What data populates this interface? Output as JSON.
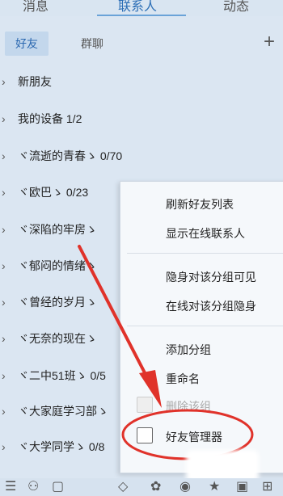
{
  "tabs": {
    "messages": "消息",
    "contacts": "联系人",
    "dynamic": "动态"
  },
  "subtabs": {
    "friends": "好友",
    "groups": "群聊"
  },
  "plus": "+",
  "list": [
    {
      "label": "新朋友"
    },
    {
      "label": "我的设备 1/2"
    },
    {
      "label": "ヾ流逝的青春ゝ  0/70"
    },
    {
      "label": "ヾ欧巴ゝ 0/23"
    },
    {
      "label": "ヾ深陷的牢房ゝ"
    },
    {
      "label": "ヾ郁闷的情绪ゝ"
    },
    {
      "label": "ヾ曾经的岁月ゝ"
    },
    {
      "label": "ヾ无奈的现在ゝ"
    },
    {
      "label": "ヾ二中51班ゝ 0/5"
    },
    {
      "label": "ヾ大家庭学习部ゝ"
    },
    {
      "label": "ヾ大学同学ゝ 0/8"
    }
  ],
  "context_menu": {
    "refresh": "刷新好友列表",
    "show_online": "显示在线联系人",
    "invisible_visible": "隐身对该分组可见",
    "online_hidden": "在线对该分组隐身",
    "add_group": "添加分组",
    "rename": "重命名",
    "delete_group": "删除该组",
    "friend_manager": "好友管理器"
  },
  "colors": {
    "accent": "#2d6fb6",
    "arrow": "#e0322a",
    "background": "#dbe6f2"
  }
}
